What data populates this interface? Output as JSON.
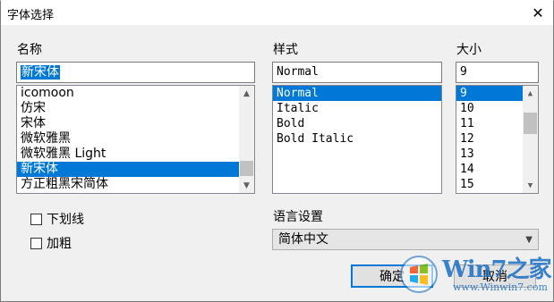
{
  "window": {
    "title": "字体选择"
  },
  "font": {
    "label": "名称",
    "value": "新宋体",
    "items": [
      "icomoon",
      "仿宋",
      "宋体",
      "微软雅黑",
      "微软雅黑 Light",
      "新宋体",
      "方正粗黑宋简体"
    ],
    "selected_index": 5
  },
  "style": {
    "label": "样式",
    "value": "Normal",
    "items": [
      "Normal",
      "Italic",
      "Bold",
      "Bold Italic"
    ],
    "selected_index": 0
  },
  "size": {
    "label": "大小",
    "value": "9",
    "items": [
      "9",
      "10",
      "11",
      "12",
      "13",
      "14",
      "15"
    ],
    "selected_index": 0
  },
  "effects": {
    "underline_label": "下划线",
    "underline_checked": false,
    "bold_label": "加粗",
    "bold_checked": false
  },
  "language": {
    "label": "语言设置",
    "value": "简体中文"
  },
  "buttons": {
    "ok_label": "确定",
    "cancel_label": "取消"
  },
  "watermark": {
    "logo_text": "Win7之家",
    "url": "www.Winwin7.com"
  }
}
